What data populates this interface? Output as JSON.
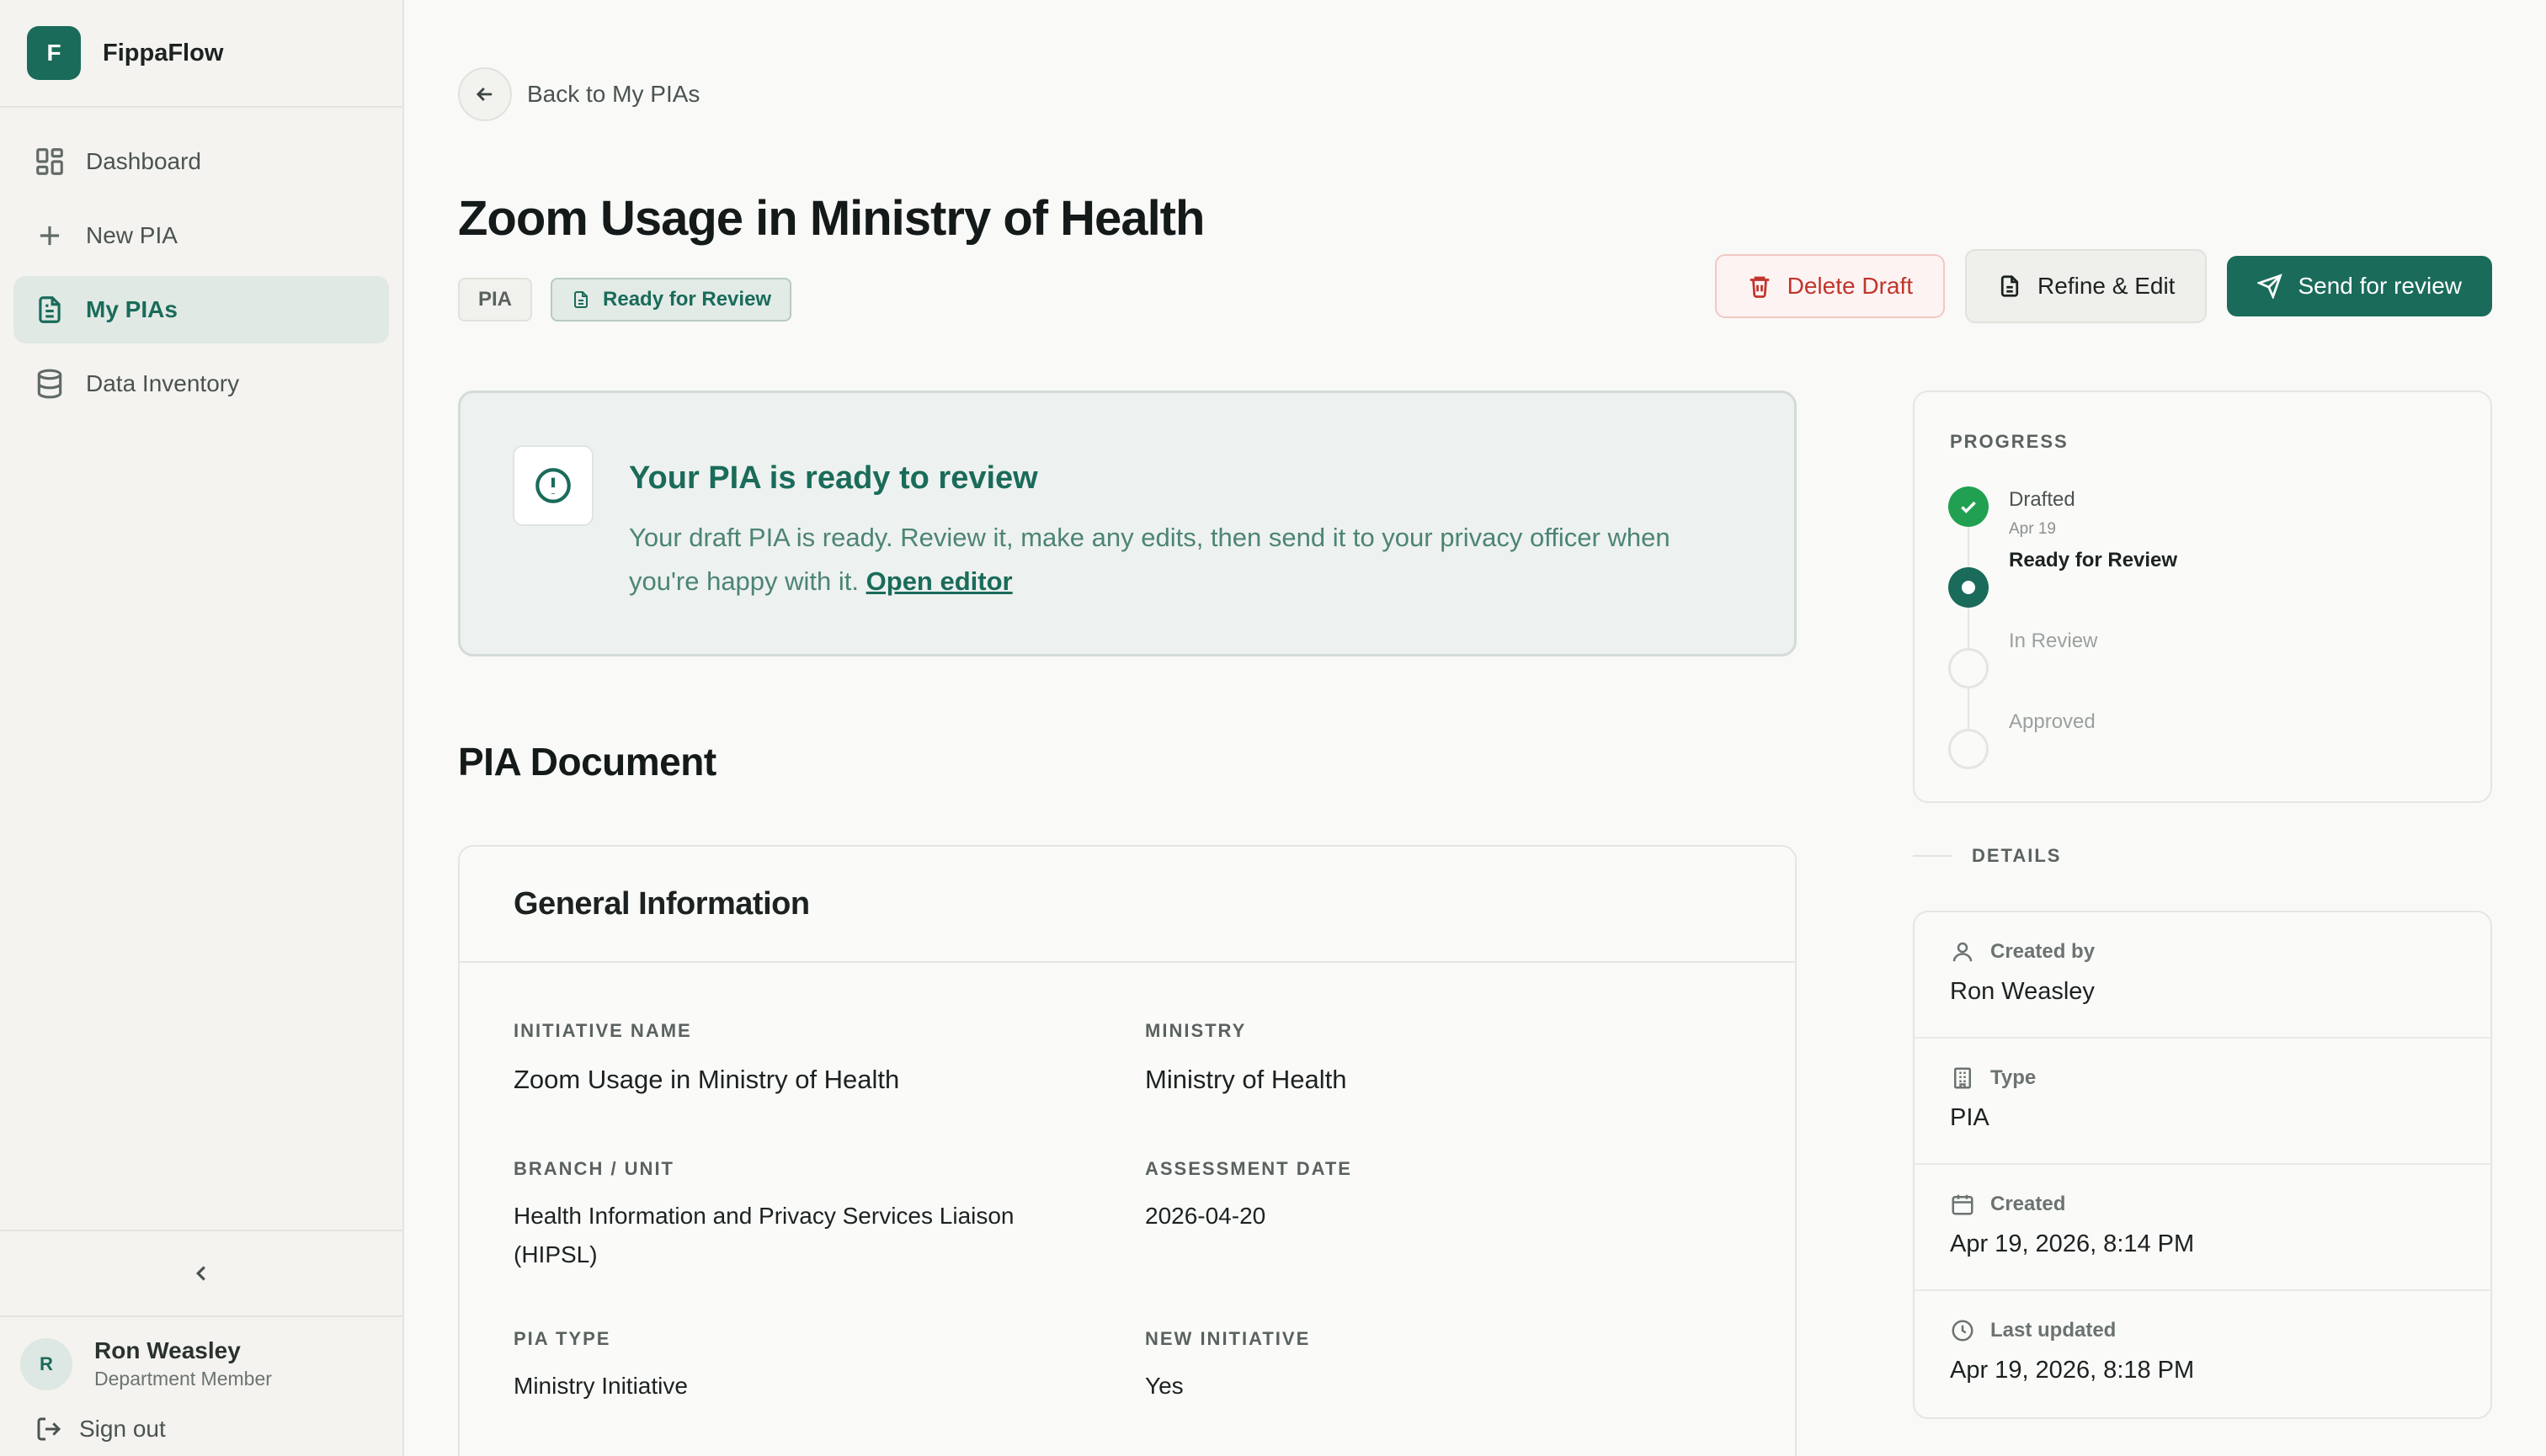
{
  "brand": {
    "logo_letter": "F",
    "name": "FippaFlow"
  },
  "sidebar": {
    "items": [
      {
        "label": "Dashboard",
        "icon": "dashboard-icon"
      },
      {
        "label": "New PIA",
        "icon": "plus-icon"
      },
      {
        "label": "My PIAs",
        "icon": "document-icon",
        "active": true
      },
      {
        "label": "Data Inventory",
        "icon": "database-icon"
      }
    ]
  },
  "user": {
    "initial": "R",
    "name": "Ron Weasley",
    "role": "Department Member",
    "sign_out": "Sign out"
  },
  "back": {
    "label": "Back to My PIAs"
  },
  "page": {
    "title": "Zoom Usage in Ministry of Health",
    "tag_type": "PIA",
    "tag_status": "Ready for Review"
  },
  "actions": {
    "delete": "Delete Draft",
    "refine": "Refine & Edit",
    "send": "Send for review"
  },
  "alert": {
    "title": "Your PIA is ready to review",
    "body": "Your draft PIA is ready. Review it, make any edits, then send it to your privacy officer when you're happy with it.",
    "link": "Open editor"
  },
  "document": {
    "section_title": "PIA Document",
    "card_title": "General Information",
    "fields": [
      {
        "label": "Initiative Name",
        "value": "Zoom Usage in Ministry of Health"
      },
      {
        "label": "Ministry",
        "value": "Ministry of Health"
      },
      {
        "label": "Branch / Unit",
        "value": "Health Information and Privacy Services Liaison (HIPSL)"
      },
      {
        "label": "Assessment Date",
        "value": "2026-04-20"
      },
      {
        "label": "PIA Type",
        "value": "Ministry Initiative"
      },
      {
        "label": "New Initiative",
        "value": "Yes"
      }
    ]
  },
  "progress": {
    "label": "PROGRESS",
    "steps": [
      {
        "name": "Drafted",
        "date": "Apr 19",
        "state": "done"
      },
      {
        "name": "Ready for Review",
        "state": "current"
      },
      {
        "name": "In Review",
        "state": "todo"
      },
      {
        "name": "Approved",
        "state": "todo"
      }
    ]
  },
  "details": {
    "label": "DETAILS",
    "rows": [
      {
        "label": "Created by",
        "value": "Ron Weasley",
        "icon": "user-icon"
      },
      {
        "label": "Type",
        "value": "PIA",
        "icon": "building-icon"
      },
      {
        "label": "Created",
        "value": "Apr 19, 2026, 8:14 PM",
        "icon": "calendar-icon"
      },
      {
        "label": "Last updated",
        "value": "Apr 19, 2026, 8:18 PM",
        "icon": "clock-icon"
      }
    ]
  },
  "colors": {
    "accent": "#1a6b5a",
    "success": "#22a052",
    "danger": "#c0352b"
  }
}
